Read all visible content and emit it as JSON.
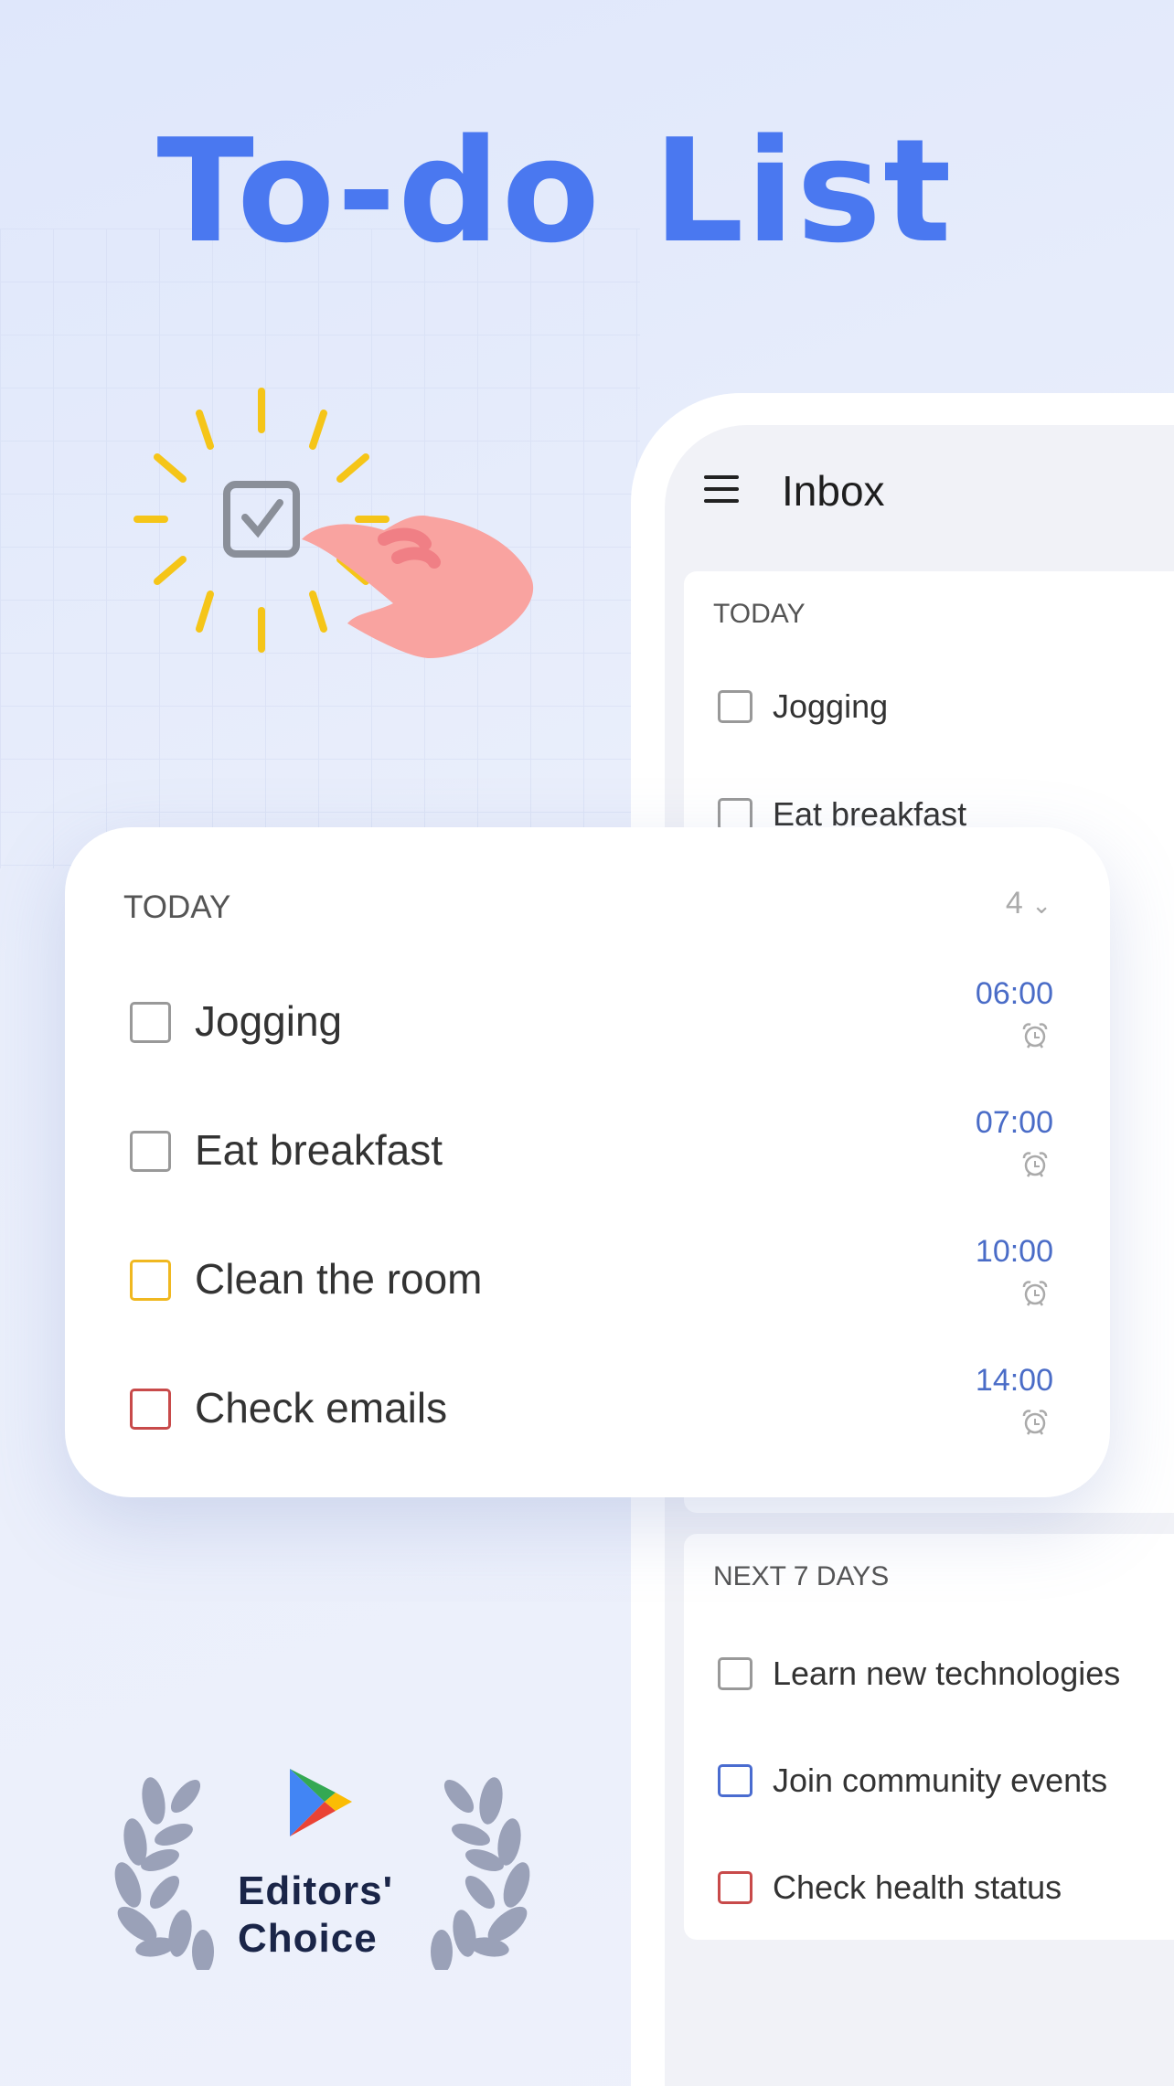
{
  "title": "To-do List",
  "colors": {
    "accent": "#4a78f0",
    "time": "#4a6cc7",
    "yellow": "#f0b820",
    "red": "#c84a4a",
    "blue": "#4a6cd0",
    "gray": "#999999"
  },
  "phone": {
    "header": {
      "menu_icon": "hamburger-icon",
      "title": "Inbox"
    },
    "today": {
      "label": "TODAY",
      "items": [
        "Jogging",
        "Eat breakfast"
      ]
    },
    "next7": {
      "label": "NEXT 7 DAYS",
      "items": [
        {
          "text": "Learn new technologies",
          "color": "#999999"
        },
        {
          "text": "Join community events",
          "color": "#4a6cd0"
        },
        {
          "text": "Check health status",
          "color": "#c84a4a"
        }
      ]
    }
  },
  "card": {
    "label": "TODAY",
    "count": "4",
    "items": [
      {
        "text": "Jogging",
        "time": "06:00",
        "color": "#999999"
      },
      {
        "text": "Eat breakfast",
        "time": "07:00",
        "color": "#999999"
      },
      {
        "text": "Clean the room",
        "time": "10:00",
        "color": "#f0b820"
      },
      {
        "text": "Check emails",
        "time": "14:00",
        "color": "#c84a4a"
      }
    ]
  },
  "badge": {
    "line1": "Editors'",
    "line2": "Choice"
  }
}
